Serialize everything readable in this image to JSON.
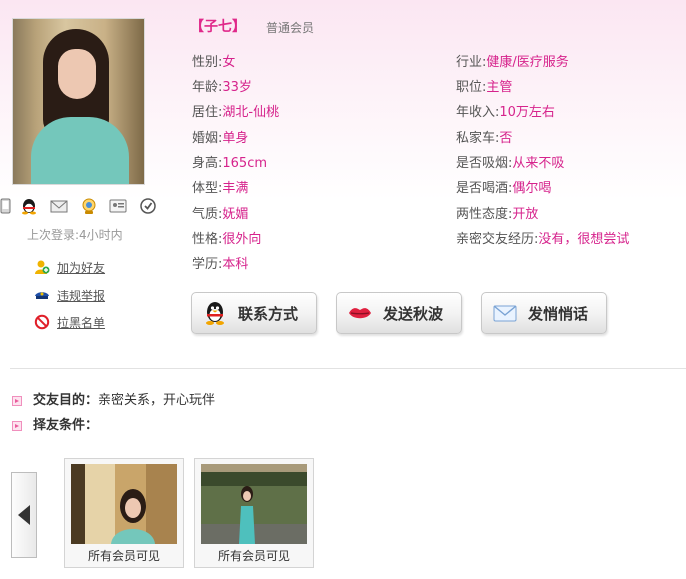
{
  "profile": {
    "nickname": "【子七】",
    "member_level": "普通会员",
    "last_login": "上次登录:4小时内"
  },
  "left_fields": [
    {
      "label": "性别:",
      "value": "女"
    },
    {
      "label": "年龄:",
      "value": "33岁"
    },
    {
      "label": "居住:",
      "value": "湖北-仙桃"
    },
    {
      "label": "婚姻:",
      "value": "单身"
    },
    {
      "label": "身高:",
      "value": "165cm"
    },
    {
      "label": "体型:",
      "value": "丰满"
    },
    {
      "label": "气质:",
      "value": "妩媚"
    },
    {
      "label": "性格:",
      "value": "很外向"
    },
    {
      "label": "学历:",
      "value": "本科"
    }
  ],
  "right_fields": [
    {
      "label": "行业:",
      "value": "健康/医疗服务"
    },
    {
      "label": "职位:",
      "value": "主管"
    },
    {
      "label": "年收入:",
      "value": "10万左右"
    },
    {
      "label": "私家车:",
      "value": "否"
    },
    {
      "label": "是否吸烟:",
      "value": "从来不吸"
    },
    {
      "label": "是否喝酒:",
      "value": "偶尔喝"
    },
    {
      "label": "两性态度:",
      "value": "开放"
    },
    {
      "label": "亲密交友经历:",
      "value": "没有，很想尝试"
    }
  ],
  "side_actions": [
    {
      "label": "加为好友",
      "icon": "add-friend-icon"
    },
    {
      "label": "违规举报",
      "icon": "police-cap-icon"
    },
    {
      "label": "拉黑名单",
      "icon": "block-icon"
    }
  ],
  "buttons": {
    "contact": "联系方式",
    "wink": "发送秋波",
    "message": "发悄悄话"
  },
  "dating": {
    "purpose_label": "交友目的：",
    "purpose_value": "亲密关系，开心玩伴",
    "criteria_label": "择友条件："
  },
  "gallery": [
    {
      "caption": "所有会员可见"
    },
    {
      "caption": "所有会员可见"
    }
  ],
  "colors": {
    "accent": "#d6238c",
    "nickname": "#e0298a",
    "header_pink": "#fbe6f2"
  }
}
